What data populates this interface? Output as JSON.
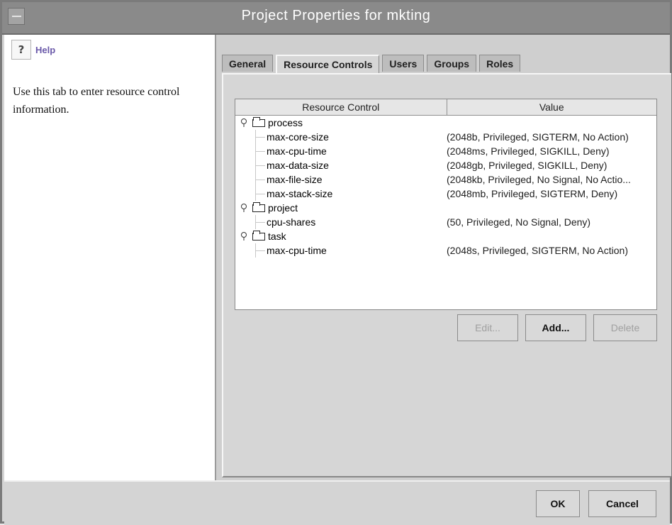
{
  "window": {
    "title": "Project Properties for mkting"
  },
  "help": {
    "title": "Help",
    "text": "Use this tab to enter resource control information."
  },
  "tabs": [
    {
      "label": "General"
    },
    {
      "label": "Resource Controls"
    },
    {
      "label": "Users"
    },
    {
      "label": "Groups"
    },
    {
      "label": "Roles"
    }
  ],
  "table": {
    "headers": [
      "Resource Control",
      "Value"
    ],
    "rows": [
      {
        "type": "group",
        "name": "process",
        "value": ""
      },
      {
        "type": "item",
        "name": "max-core-size",
        "value": "(2048b, Privileged, SIGTERM, No Action)"
      },
      {
        "type": "item",
        "name": "max-cpu-time",
        "value": "(2048ms, Privileged, SIGKILL, Deny)"
      },
      {
        "type": "item",
        "name": "max-data-size",
        "value": "(2048gb, Privileged, SIGKILL, Deny)"
      },
      {
        "type": "item",
        "name": "max-file-size",
        "value": "(2048kb, Privileged, No Signal, No Actio..."
      },
      {
        "type": "item",
        "name": "max-stack-size",
        "value": "(2048mb, Privileged, SIGTERM, Deny)"
      },
      {
        "type": "group",
        "name": "project",
        "value": ""
      },
      {
        "type": "item",
        "name": "cpu-shares",
        "value": "(50, Privileged, No Signal, Deny)"
      },
      {
        "type": "group",
        "name": "task",
        "value": ""
      },
      {
        "type": "item",
        "name": "max-cpu-time",
        "value": "(2048s, Privileged, SIGTERM, No Action)"
      }
    ]
  },
  "buttons": {
    "edit": "Edit...",
    "add": "Add...",
    "delete": "Delete",
    "ok": "OK",
    "cancel": "Cancel"
  }
}
